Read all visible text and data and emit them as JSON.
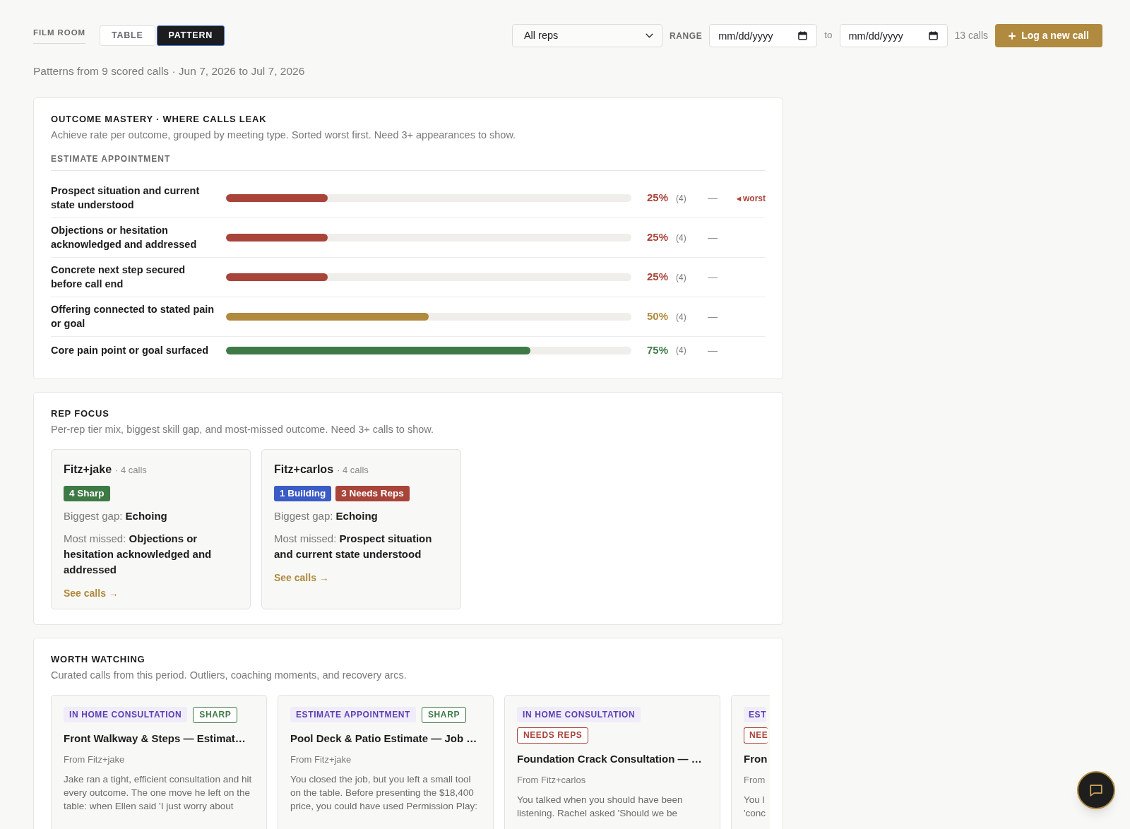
{
  "header": {
    "section_label": "FILM ROOM",
    "view_tabs": [
      {
        "label": "TABLE",
        "selected": false
      },
      {
        "label": "PATTERN",
        "selected": true
      }
    ],
    "rep_filter": {
      "value": "All reps"
    },
    "range_label": "RANGE",
    "date_from": {
      "placeholder": "mm/dd/yyyy"
    },
    "range_separator": "to",
    "date_to": {
      "placeholder": "mm/dd/yyyy"
    },
    "call_count": "13 calls",
    "new_call_button": {
      "label": "Log a new call"
    }
  },
  "summary": "Patterns from 9 scored calls · Jun 7, 2026 to Jul 7, 2026",
  "outcome_mastery": {
    "title": "OUTCOME MASTERY · WHERE CALLS LEAK",
    "description": "Achieve rate per outcome, grouped by meeting type. Sorted worst first. Need 3+ appearances to show.",
    "groups": [
      {
        "heading": "ESTIMATE APPOINTMENT",
        "rows": [
          {
            "label": "Prospect situation and current state understood",
            "level": 0.25,
            "percent": "25%",
            "count": "(4)",
            "trend": "—",
            "flag": "◂ worst"
          },
          {
            "label": "Objections or hesitation acknowledged and addressed",
            "level": 0.25,
            "percent": "25%",
            "count": "(4)",
            "trend": "—"
          },
          {
            "label": "Concrete next step secured before call end",
            "level": 0.25,
            "percent": "25%",
            "count": "(4)",
            "trend": "—"
          },
          {
            "label": "Offering connected to stated pain or goal",
            "level": 0.5,
            "percent": "50%",
            "count": "(4)",
            "trend": "—"
          },
          {
            "label": "Core pain point or goal surfaced",
            "level": 0.75,
            "percent": "75%",
            "count": "(4)",
            "trend": "—"
          }
        ]
      }
    ]
  },
  "rep_focus": {
    "title": "REP FOCUS",
    "description": "Per-rep tier mix, biggest skill gap, and most-missed outcome. Need 3+ calls to show.",
    "reps": [
      {
        "name": "Fitz+jake",
        "calls": "· 4 calls",
        "tiers": [
          {
            "label": "4 Sharp",
            "kind": "sharp"
          }
        ],
        "gap": "Biggest gap: **Echoing**",
        "missed": "Most missed: **Objections or hesitation acknowledged and addressed**",
        "link": "See calls →"
      },
      {
        "name": "Fitz+carlos",
        "calls": "· 4 calls",
        "tiers": [
          {
            "label": "1 Building",
            "kind": "building"
          },
          {
            "label": "3 Needs Reps",
            "kind": "needs_reps"
          }
        ],
        "gap": "Biggest gap: **Echoing**",
        "missed": "Most missed: **Prospect situation and current state understood**",
        "link": "See calls →"
      }
    ]
  },
  "worth_watching": {
    "title": "WORTH WATCHING",
    "description": "Curated calls from this period. Outliers, coaching moments, and recovery arcs.",
    "calls": [
      {
        "meeting_type": "IN HOME CONSULTATION",
        "tier": {
          "label": "SHARP",
          "kind": "sharp"
        },
        "title": "Front Walkway & Steps — Estimat…",
        "from": "From Fitz+jake",
        "summary": "Jake ran a tight, efficient consultation and hit every outcome. The one move he left on the table: when Ellen said 'I just worry about"
      },
      {
        "meeting_type": "ESTIMATE APPOINTMENT",
        "tier": {
          "label": "SHARP",
          "kind": "sharp"
        },
        "title": "Pool Deck & Patio Estimate — Job …",
        "from": "From Fitz+jake",
        "summary": "You closed the job, but you left a small tool on the table. Before presenting the $18,400 price, you could have used Permission Play:"
      },
      {
        "meeting_type": "IN HOME CONSULTATION",
        "tier": {
          "label": "NEEDS REPS",
          "kind": "needs_reps"
        },
        "title": "Foundation Crack Consultation — …",
        "from": "From Fitz+carlos",
        "summary": "You talked when you should have been listening. Rachel asked 'Should we be"
      },
      {
        "meeting_type": "EST",
        "tier": {
          "label": "NEE",
          "kind": "needs_reps"
        },
        "title": "Fron",
        "from": "From",
        "summary": "You l\n'conc"
      }
    ]
  }
}
